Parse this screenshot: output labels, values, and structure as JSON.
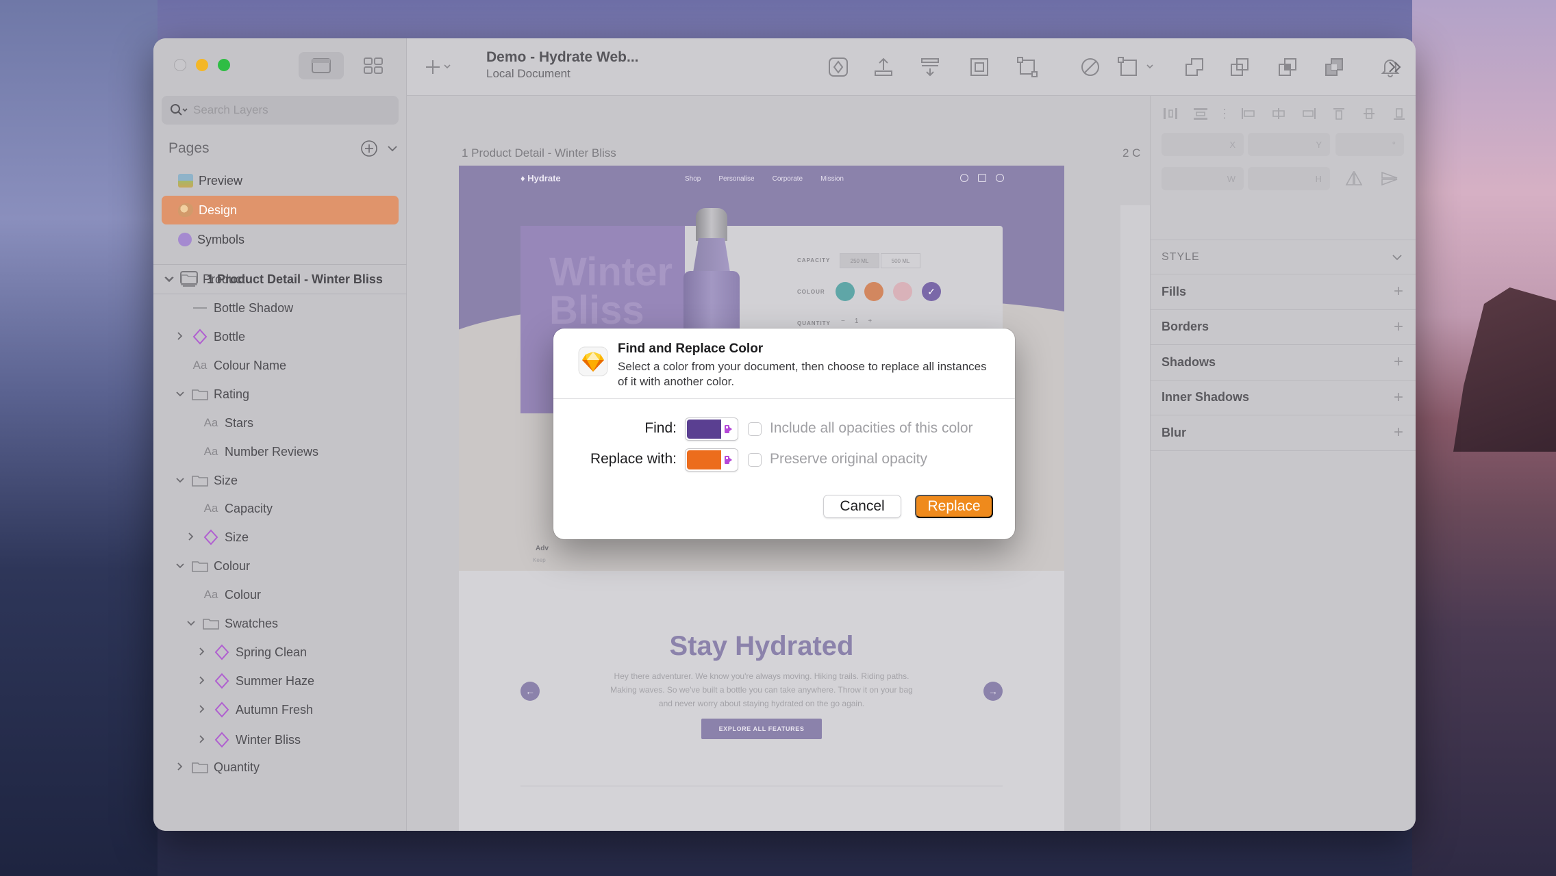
{
  "window": {
    "document_title": "Demo - Hydrate Web...",
    "document_subtitle": "Local Document"
  },
  "sidebar": {
    "search_placeholder": "Search Layers",
    "pages_label": "Pages",
    "pages": [
      {
        "label": "Preview",
        "icon": "image-icon",
        "selected": false
      },
      {
        "label": "Design",
        "icon": "palette-icon",
        "selected": true
      },
      {
        "label": "Symbols",
        "icon": "purple-circle-icon",
        "selected": false
      }
    ],
    "artboard": "1 Product Detail - Winter Bliss",
    "layers": [
      {
        "label": "Product",
        "type": "group",
        "expanded": true
      },
      {
        "label": "Bottle Shadow",
        "type": "line"
      },
      {
        "label": "Bottle",
        "type": "symbol",
        "expandable": true
      },
      {
        "label": "Colour Name",
        "type": "text"
      },
      {
        "label": "Rating",
        "type": "group",
        "expanded": true
      },
      {
        "label": "Stars",
        "type": "text"
      },
      {
        "label": "Number Reviews",
        "type": "text"
      },
      {
        "label": "Size",
        "type": "group",
        "expanded": true
      },
      {
        "label": "Capacity",
        "type": "text"
      },
      {
        "label": "Size",
        "type": "symbol",
        "expandable": true
      },
      {
        "label": "Colour",
        "type": "group",
        "expanded": true
      },
      {
        "label": "Colour",
        "type": "text"
      },
      {
        "label": "Swatches",
        "type": "group",
        "expanded": true
      },
      {
        "label": "Spring Clean",
        "type": "symbol",
        "expandable": true
      },
      {
        "label": "Summer Haze",
        "type": "symbol",
        "expandable": true
      },
      {
        "label": "Autumn Fresh",
        "type": "symbol",
        "expandable": true
      },
      {
        "label": "Winter Bliss",
        "type": "symbol",
        "expandable": true
      },
      {
        "label": "Quantity",
        "type": "group",
        "expanded": false
      }
    ]
  },
  "canvas": {
    "artboard_label": "1 Product Detail - Winter Bliss",
    "artboard2_label": "2 C",
    "site": {
      "logo": "Hydrate",
      "nav_links": [
        "Shop",
        "Personalise",
        "Corporate",
        "Mission"
      ],
      "hero_title": "Winter Bliss",
      "capacity_label": "CAPACITY",
      "capacity_options": [
        "250 ML",
        "500 ML"
      ],
      "colour_label": "COLOUR",
      "swatch_colors": [
        "#5fa6a7",
        "#d2875f",
        "#d9b2b9",
        "#7a68a8"
      ],
      "quantity_label": "QUANTITY",
      "quantity_minus": "−",
      "quantity_value": "1",
      "quantity_plus": "+",
      "adv_title": "Adv",
      "adv_sub": "Keep",
      "section_title": "Stay Hydrated",
      "section_text": "Hey there adventurer. We know you're always moving. Hiking trails. Riding paths. Making waves. So we've built a bottle you can take anywhere. Throw it on your bag and never worry about staying hydrated on the go again.",
      "explore_button": "EXPLORE ALL FEATURES",
      "prev_arrow": "←",
      "next_arrow": "→"
    }
  },
  "inspector": {
    "fields": {
      "x": "X",
      "y": "Y",
      "rotation": "°",
      "w": "W",
      "h": "H"
    },
    "style_label": "STYLE",
    "sections": [
      "Fills",
      "Borders",
      "Shadows",
      "Inner Shadows",
      "Blur"
    ]
  },
  "dialog": {
    "title": "Find and Replace Color",
    "description": "Select a color from your document, then choose to replace all instances of it with another color.",
    "find_label": "Find:",
    "find_color": "#5a3f91",
    "find_option": "Include all opacities of this color",
    "replace_label": "Replace with:",
    "replace_color": "#ec6d1d",
    "replace_option": "Preserve original opacity",
    "cancel_button": "Cancel",
    "replace_button": "Replace"
  }
}
